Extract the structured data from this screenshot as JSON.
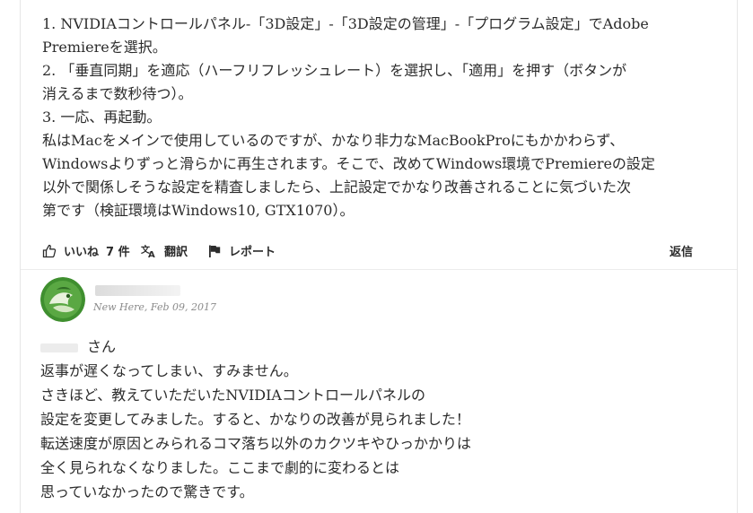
{
  "post": {
    "lines": [
      "1. NVIDIAコントロールパネル-「3D設定」-「3D設定の管理」-「プログラム設定」でAdobe",
      "Premiereを選択。",
      "2. 「垂直同期」を適応（ハーフリフレッシュレート）を選択し、「適用」を押す（ボタンが",
      "消えるまで数秒待つ）。",
      "3. 一応、再起動。",
      "私はMacをメインで使用しているのですが、かなり非力なMacBookProにもかかわらず、",
      "Windowsよりずっと滑らかに再生されます。そこで、改めてWindows環境でPremiereの設定",
      "以外で関係しそうな設定を精査しましたら、上記設定でかなり改善されることに気づいた次",
      "第です（検証環境はWindows10, GTX1070）。"
    ]
  },
  "actions": {
    "like_label": "いいね",
    "like_count": "7 件",
    "translate_label": "翻訳",
    "report_label": "レポート",
    "reply_label": "返信"
  },
  "icons": {
    "like": "thumbs-up-icon",
    "translate": "translate-icon",
    "report": "flag-icon"
  },
  "reply": {
    "author_rank": "New Here",
    "date": "Feb 09, 2017",
    "salutation": "さん",
    "lines": [
      "返事が遅くなってしまい、すみません。",
      "さきほど、教えていただいたNVIDIAコントロールパネルの",
      "設定を変更してみました。すると、かなりの改善が見られました！",
      "転送速度が原因とみられるコマ落ち以外のカクツキやひっかかりは",
      "全く見られなくなりました。ここまで劇的に変わるとは",
      "思っていなかったので驚きです。"
    ]
  },
  "colors": {
    "text": "#2c2c2c",
    "meta": "#8a8a8a",
    "avatar_green": "#3f8f2f"
  }
}
